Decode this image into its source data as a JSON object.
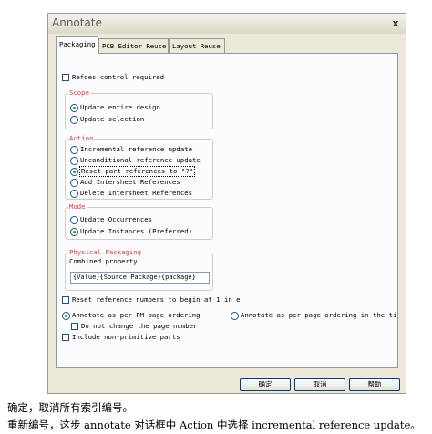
{
  "dialog": {
    "title": "Annotate",
    "close_glyph": "x",
    "tabs": [
      {
        "label": "Packaging"
      },
      {
        "label": "PCB Editor Reuse"
      },
      {
        "label": "Layout Reuse"
      }
    ],
    "refdes_control": {
      "label": "Refdes control required",
      "checked": false
    },
    "scope": {
      "legend": "Scope",
      "options": [
        {
          "label": "Update entire design",
          "selected": true
        },
        {
          "label": "Update selection",
          "selected": false
        }
      ]
    },
    "action": {
      "legend": "Action",
      "options": [
        {
          "label": "Incremental reference update",
          "selected": false
        },
        {
          "label": "Unconditional reference update",
          "selected": false
        },
        {
          "label": "Reset part references to \"?\"",
          "selected": true
        },
        {
          "label": "Add Intersheet References",
          "selected": false
        },
        {
          "label": "Delete Intersheet References",
          "selected": false
        }
      ]
    },
    "mode": {
      "legend": "Mode",
      "options": [
        {
          "label": "Update Occurrences",
          "selected": false
        },
        {
          "label": "Update Instances (Preferred)",
          "selected": true
        }
      ]
    },
    "physical_packaging": {
      "legend": "Physical Packaging",
      "combined_label": "Combined property",
      "combined_value": "{Value}{Source Package}{package}"
    },
    "reset_numbers": {
      "label": "Reset reference numbers to begin at 1 in e",
      "checked": false
    },
    "annotate_per_pm": {
      "label": "Annotate as per PM page ordering",
      "selected": true
    },
    "annotate_per_page": {
      "label": "Annotate as per page ordering in the ti",
      "selected": false
    },
    "do_not_change": {
      "label": "Do not change the page number",
      "checked": false
    },
    "include_non_primitive": {
      "label": "Include non-primitive parts",
      "checked": false
    },
    "buttons": {
      "ok": "确定",
      "cancel": "取消",
      "help": "帮助"
    }
  },
  "caption": {
    "line1": "确定，取消所有索引编号。",
    "line2": "重新编号，这步 annotate 对话框中 Action 中选择 incremental reference update。"
  },
  "colors": {
    "dialog_bg": "#ece9d8",
    "panel_bg": "#fcfcfe",
    "legend": "#d04040",
    "radio_dot": "#2b9a3a"
  }
}
